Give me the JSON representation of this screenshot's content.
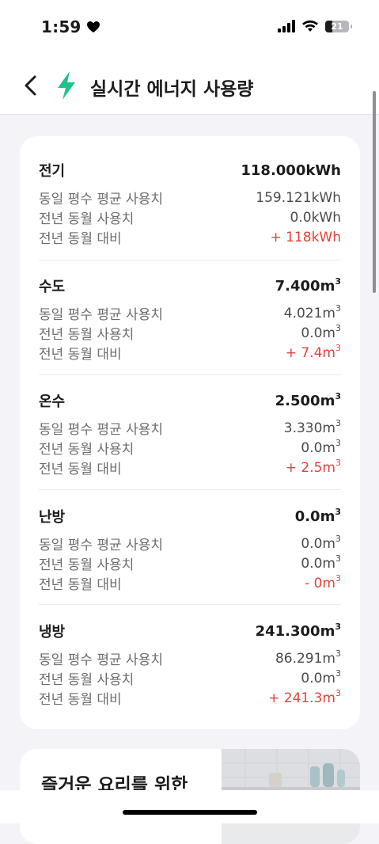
{
  "status": {
    "time": "1:59",
    "battery": "21"
  },
  "nav": {
    "title": "실시간 에너지 사용량"
  },
  "sections": [
    {
      "name": "전기",
      "total": "118.000kWh",
      "unit": "",
      "rows": [
        {
          "label": "동일 평수 평균 사용치",
          "value": "159.121kWh"
        },
        {
          "label": "전년 동월 사용치",
          "value": "0.0kWh"
        },
        {
          "label": "전년 동월 대비",
          "value": "+ 118kWh"
        }
      ]
    },
    {
      "name": "수도",
      "total": "7.400m",
      "unit": "3",
      "rows": [
        {
          "label": "동일 평수 평균 사용치",
          "value": "4.021m"
        },
        {
          "label": "전년 동월 사용치",
          "value": "0.0m"
        },
        {
          "label": "전년 동월 대비",
          "value": "+ 7.4m"
        }
      ]
    },
    {
      "name": "온수",
      "total": "2.500m",
      "unit": "3",
      "rows": [
        {
          "label": "동일 평수 평균 사용치",
          "value": "3.330m"
        },
        {
          "label": "전년 동월 사용치",
          "value": "0.0m"
        },
        {
          "label": "전년 동월 대비",
          "value": "+ 2.5m"
        }
      ]
    },
    {
      "name": "난방",
      "total": "0.0m",
      "unit": "3",
      "rows": [
        {
          "label": "동일 평수 평균 사용치",
          "value": "0.0m"
        },
        {
          "label": "전년 동월 사용치",
          "value": "0.0m"
        },
        {
          "label": "전년 동월 대비",
          "value": "- 0m"
        }
      ]
    },
    {
      "name": "냉방",
      "total": "241.300m",
      "unit": "3",
      "rows": [
        {
          "label": "동일 평수 평균 사용치",
          "value": "86.291m"
        },
        {
          "label": "전년 동월 사용치",
          "value": "0.0m"
        },
        {
          "label": "전년 동월 대비",
          "value": "+ 241.3m"
        }
      ]
    }
  ],
  "promo": {
    "title": "즐거운 요리를 위한"
  },
  "colors": {
    "accent": "#1ec28b",
    "positive": "#e5413a",
    "muted": "#6c6c70"
  },
  "icons": [
    "back-chevron-icon",
    "lightning-bolt-icon",
    "signal-icon",
    "wifi-icon",
    "battery-icon",
    "heart-icon"
  ]
}
